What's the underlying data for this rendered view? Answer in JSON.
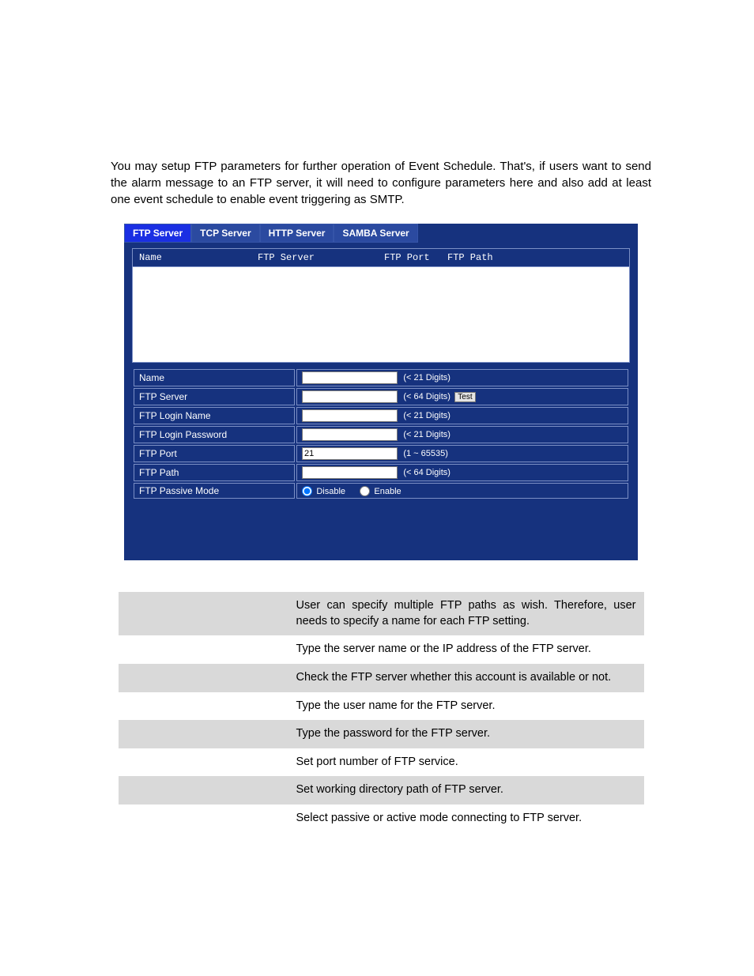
{
  "intro": "You may setup FTP parameters for further operation of Event Schedule. That's, if users want to send the alarm message to an FTP server, it will need to configure parameters here and also add at least one event schedule to enable event triggering as SMTP.",
  "tabs": [
    {
      "label": "FTP Server",
      "active": true
    },
    {
      "label": "TCP Server",
      "active": false
    },
    {
      "label": "HTTP Server",
      "active": false
    },
    {
      "label": "SAMBA Server",
      "active": false
    }
  ],
  "list_header": {
    "name": "Name",
    "server": "FTP Server",
    "port": "FTP Port",
    "path": "FTP Path"
  },
  "form": {
    "name": {
      "label": "Name",
      "value": "",
      "hint": "(< 21 Digits)"
    },
    "server": {
      "label": "FTP Server",
      "value": "",
      "hint": "(< 64 Digits)",
      "test": "Test"
    },
    "login_name": {
      "label": "FTP Login Name",
      "value": "",
      "hint": "(< 21 Digits)"
    },
    "login_password": {
      "label": "FTP Login Password",
      "value": "",
      "hint": "(< 21 Digits)"
    },
    "port": {
      "label": "FTP Port",
      "value": "21",
      "hint": "(1 ~ 65535)"
    },
    "path": {
      "label": "FTP Path",
      "value": "",
      "hint": "(< 64 Digits)"
    },
    "passive": {
      "label": "FTP Passive Mode",
      "disable": "Disable",
      "enable": "Enable"
    }
  },
  "desc": [
    {
      "label": "",
      "text": "User can specify multiple FTP paths as wish. Therefore, user needs to specify a name for each FTP setting."
    },
    {
      "label": "",
      "text": "Type the server name or the IP address of the FTP server."
    },
    {
      "label": "",
      "text": "Check the FTP server whether this account is available or not."
    },
    {
      "label": "",
      "text": "Type the user name for the FTP server."
    },
    {
      "label": "",
      "text": "Type the password for the FTP server."
    },
    {
      "label": "",
      "text": "Set port number of FTP service."
    },
    {
      "label": "",
      "text": "Set working directory path of FTP server."
    },
    {
      "label": "",
      "text": "Select passive or active mode connecting to FTP server."
    }
  ]
}
